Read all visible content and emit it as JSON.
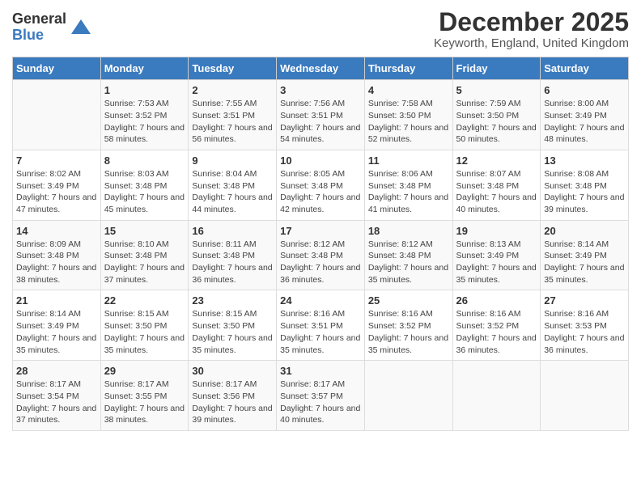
{
  "header": {
    "logo_general": "General",
    "logo_blue": "Blue",
    "month_title": "December 2025",
    "location": "Keyworth, England, United Kingdom"
  },
  "weekdays": [
    "Sunday",
    "Monday",
    "Tuesday",
    "Wednesday",
    "Thursday",
    "Friday",
    "Saturday"
  ],
  "weeks": [
    [
      {
        "day": "",
        "info": ""
      },
      {
        "day": "1",
        "info": "Sunrise: 7:53 AM\nSunset: 3:52 PM\nDaylight: 7 hours\nand 58 minutes."
      },
      {
        "day": "2",
        "info": "Sunrise: 7:55 AM\nSunset: 3:51 PM\nDaylight: 7 hours\nand 56 minutes."
      },
      {
        "day": "3",
        "info": "Sunrise: 7:56 AM\nSunset: 3:51 PM\nDaylight: 7 hours\nand 54 minutes."
      },
      {
        "day": "4",
        "info": "Sunrise: 7:58 AM\nSunset: 3:50 PM\nDaylight: 7 hours\nand 52 minutes."
      },
      {
        "day": "5",
        "info": "Sunrise: 7:59 AM\nSunset: 3:50 PM\nDaylight: 7 hours\nand 50 minutes."
      },
      {
        "day": "6",
        "info": "Sunrise: 8:00 AM\nSunset: 3:49 PM\nDaylight: 7 hours\nand 48 minutes."
      }
    ],
    [
      {
        "day": "7",
        "info": "Sunrise: 8:02 AM\nSunset: 3:49 PM\nDaylight: 7 hours\nand 47 minutes."
      },
      {
        "day": "8",
        "info": "Sunrise: 8:03 AM\nSunset: 3:48 PM\nDaylight: 7 hours\nand 45 minutes."
      },
      {
        "day": "9",
        "info": "Sunrise: 8:04 AM\nSunset: 3:48 PM\nDaylight: 7 hours\nand 44 minutes."
      },
      {
        "day": "10",
        "info": "Sunrise: 8:05 AM\nSunset: 3:48 PM\nDaylight: 7 hours\nand 42 minutes."
      },
      {
        "day": "11",
        "info": "Sunrise: 8:06 AM\nSunset: 3:48 PM\nDaylight: 7 hours\nand 41 minutes."
      },
      {
        "day": "12",
        "info": "Sunrise: 8:07 AM\nSunset: 3:48 PM\nDaylight: 7 hours\nand 40 minutes."
      },
      {
        "day": "13",
        "info": "Sunrise: 8:08 AM\nSunset: 3:48 PM\nDaylight: 7 hours\nand 39 minutes."
      }
    ],
    [
      {
        "day": "14",
        "info": "Sunrise: 8:09 AM\nSunset: 3:48 PM\nDaylight: 7 hours\nand 38 minutes."
      },
      {
        "day": "15",
        "info": "Sunrise: 8:10 AM\nSunset: 3:48 PM\nDaylight: 7 hours\nand 37 minutes."
      },
      {
        "day": "16",
        "info": "Sunrise: 8:11 AM\nSunset: 3:48 PM\nDaylight: 7 hours\nand 36 minutes."
      },
      {
        "day": "17",
        "info": "Sunrise: 8:12 AM\nSunset: 3:48 PM\nDaylight: 7 hours\nand 36 minutes."
      },
      {
        "day": "18",
        "info": "Sunrise: 8:12 AM\nSunset: 3:48 PM\nDaylight: 7 hours\nand 35 minutes."
      },
      {
        "day": "19",
        "info": "Sunrise: 8:13 AM\nSunset: 3:49 PM\nDaylight: 7 hours\nand 35 minutes."
      },
      {
        "day": "20",
        "info": "Sunrise: 8:14 AM\nSunset: 3:49 PM\nDaylight: 7 hours\nand 35 minutes."
      }
    ],
    [
      {
        "day": "21",
        "info": "Sunrise: 8:14 AM\nSunset: 3:49 PM\nDaylight: 7 hours\nand 35 minutes."
      },
      {
        "day": "22",
        "info": "Sunrise: 8:15 AM\nSunset: 3:50 PM\nDaylight: 7 hours\nand 35 minutes."
      },
      {
        "day": "23",
        "info": "Sunrise: 8:15 AM\nSunset: 3:50 PM\nDaylight: 7 hours\nand 35 minutes."
      },
      {
        "day": "24",
        "info": "Sunrise: 8:16 AM\nSunset: 3:51 PM\nDaylight: 7 hours\nand 35 minutes."
      },
      {
        "day": "25",
        "info": "Sunrise: 8:16 AM\nSunset: 3:52 PM\nDaylight: 7 hours\nand 35 minutes."
      },
      {
        "day": "26",
        "info": "Sunrise: 8:16 AM\nSunset: 3:52 PM\nDaylight: 7 hours\nand 36 minutes."
      },
      {
        "day": "27",
        "info": "Sunrise: 8:16 AM\nSunset: 3:53 PM\nDaylight: 7 hours\nand 36 minutes."
      }
    ],
    [
      {
        "day": "28",
        "info": "Sunrise: 8:17 AM\nSunset: 3:54 PM\nDaylight: 7 hours\nand 37 minutes."
      },
      {
        "day": "29",
        "info": "Sunrise: 8:17 AM\nSunset: 3:55 PM\nDaylight: 7 hours\nand 38 minutes."
      },
      {
        "day": "30",
        "info": "Sunrise: 8:17 AM\nSunset: 3:56 PM\nDaylight: 7 hours\nand 39 minutes."
      },
      {
        "day": "31",
        "info": "Sunrise: 8:17 AM\nSunset: 3:57 PM\nDaylight: 7 hours\nand 40 minutes."
      },
      {
        "day": "",
        "info": ""
      },
      {
        "day": "",
        "info": ""
      },
      {
        "day": "",
        "info": ""
      }
    ]
  ]
}
